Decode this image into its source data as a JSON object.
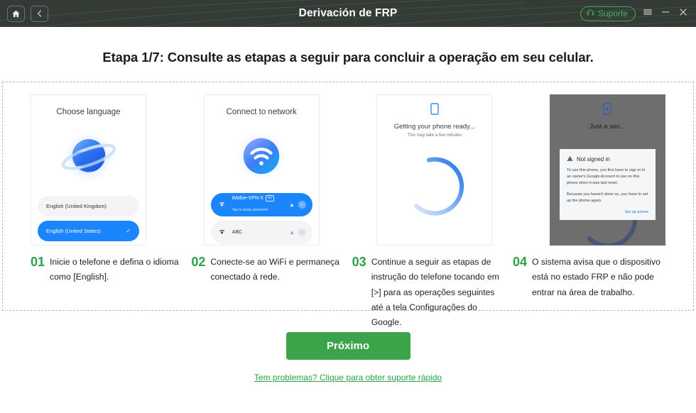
{
  "titlebar": {
    "title": "Derivación de FRP",
    "home_label": "Home",
    "back_label": "Back",
    "support_label": "Suporte",
    "menu_label": "Menu",
    "minimize_label": "Minimize",
    "close_label": "Close",
    "background_color": "#343b37",
    "accent_color": "#45b55a"
  },
  "heading": {
    "text": "Etapa 1/7: Consulte as etapas a seguir para concluir a operação em seu celular."
  },
  "cards": [
    {
      "title": "Choose language",
      "icon": "globe-icon",
      "options": [
        {
          "label": "English (United Kingdom)",
          "selected": false
        },
        {
          "label": "English (United States)",
          "selected": true,
          "check": "✓"
        }
      ]
    },
    {
      "title": "Connect to network",
      "icon": "wifi-icon",
      "networks": [
        {
          "name": "iMobie-VPN-X",
          "badge": "5G",
          "sub": "Tap to share password",
          "selected": true
        },
        {
          "name": "ABC",
          "badge": "",
          "sub": "",
          "selected": false
        }
      ]
    },
    {
      "icon": "phone-icon",
      "title": "Getting your phone ready...",
      "subtitle": "This may take a few minutes"
    },
    {
      "icon": "phone-lock-icon",
      "title": "Just a sec...",
      "dialog": {
        "icon": "warning-icon",
        "heading": "Not signed in",
        "paragraph1": "To use this phone, you first have to sign in to an owner's Google Account in use on this phone when it was last reset.",
        "paragraph2": "Because you haven't done so, you have to set up the phone again.",
        "action": "Set up phone"
      }
    }
  ],
  "captions": [
    {
      "num": "01",
      "text": "Inicie o telefone e defina o idioma como [English]."
    },
    {
      "num": "02",
      "text": "Conecte-se ao WiFi e permaneça conectado à rede."
    },
    {
      "num": "03",
      "text": "Continue a seguir as etapas de instrução do telefone tocando em [>] para as operações seguintes até a tela Configurações do Google."
    },
    {
      "num": "04",
      "text": "O sistema avisa que o dispositivo está no estado FRP e não pode entrar na área de trabalho."
    }
  ],
  "footer": {
    "next_label": "Próximo",
    "help_label": "Tem problemas? Clique para obter suporte rápido",
    "button_color": "#3ba349"
  }
}
